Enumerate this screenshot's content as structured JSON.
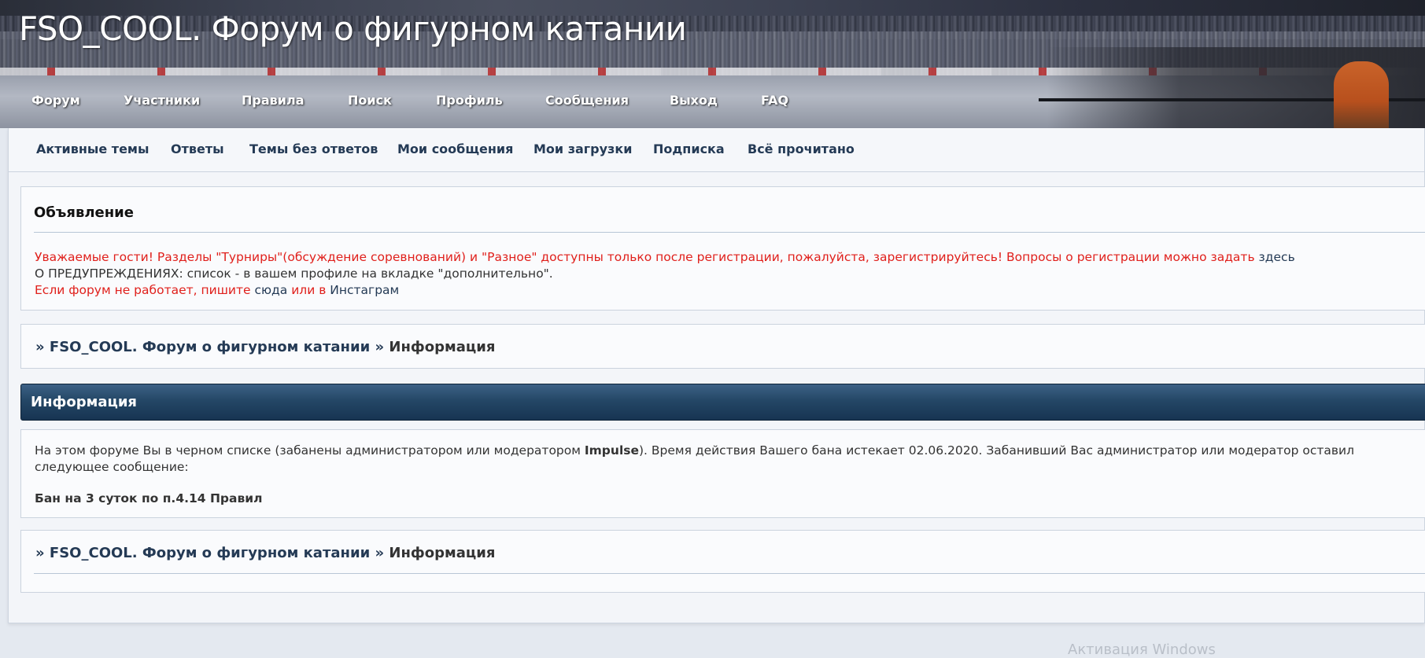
{
  "site": {
    "title": "FSO_COOL. Форум о фигурном катании"
  },
  "main_nav": [
    "Форум",
    "Участники",
    "Правила",
    "Поиск",
    "Профиль",
    "Сообщения",
    "Выход",
    "FAQ"
  ],
  "sub_nav": [
    "Активные темы",
    "Ответы",
    "Темы без ответов",
    "Мои сообщения",
    "Мои загрузки",
    "Подписка",
    "Всё прочитано"
  ],
  "announcement": {
    "title": "Объявление",
    "line1": "Уважаемые гости! Разделы \"Турниры\"(обсуждение соревнований) и \"Разное\" доступны только после регистрации, пожалуйста, зарегистрируйтесь! Вопросы о регистрации можно задать",
    "line1_link": "здесь",
    "line2": "О ПРЕДУПРЕЖДЕНИЯХ: список - в вашем профиле на вкладке \"дополнительно\".",
    "line3_a": "Если форум не работает, пишите",
    "line3_link1": "сюда",
    "line3_b": "или в",
    "line3_link2": "Инстаграм"
  },
  "breadcrumb": {
    "sep": "»",
    "home": "FSO_COOL. Форум о фигурном катании",
    "current": "Информация"
  },
  "info": {
    "header": "Информация",
    "msg_before": "На этом форуме Вы в черном списке (забанены администратором или модератором ",
    "moderator": "Impulse",
    "msg_after": "). Время действия Вашего бана истекает 02.06.2020. Забанивший Вас администратор или модератор оставил следующее сообщение:",
    "reason": "Бан на 3 суток по п.4.14 Правил"
  },
  "watermark": "Активация Windows",
  "colors": {
    "accent_red": "#e0201c",
    "link_blue": "#243a55",
    "header_blue": "#244766"
  }
}
